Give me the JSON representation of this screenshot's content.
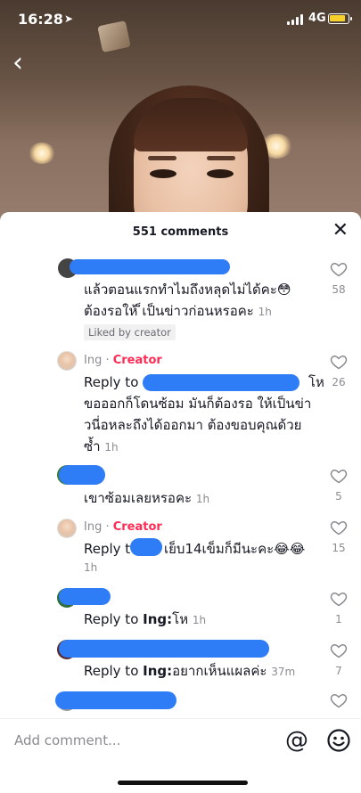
{
  "status_bar": {
    "time": "16:28",
    "network": "4G",
    "battery_color": "#f7d02c"
  },
  "sheet": {
    "comment_count": "551 comments"
  },
  "comments": [
    {
      "text_line1": "แล้วตอนแรกทำไมถึงหลุดไม่ได้คะ😳",
      "text_line2": "ต้องรอให้ ็เป็นข่าวก่อนหรอคะ",
      "time": "1h",
      "likes": "58",
      "badge": "Liked by creator"
    },
    {
      "username": "Ing",
      "creator_label": "Creator",
      "reply_prefix": "Reply to",
      "text_end": "โห",
      "text_line2": "ขอออกก็โดนซ้อม มันก็ต้องรอ ให้เป็นข่า",
      "text_line3": "วนี่อหละถึงได้ออกมา ต้องขอบคุณด้วย",
      "text_line4": "ซ้ำ",
      "time": "1h",
      "likes": "26"
    },
    {
      "text": "เขาซ้อมเลยหรอคะ",
      "time": "1h",
      "likes": "5"
    },
    {
      "username": "Ing",
      "creator_label": "Creator",
      "reply_prefix": "Reply t",
      "text_end": "เย็บ14เข็มก็มีนะคะ😂😂",
      "time": "1h",
      "likes": "15"
    },
    {
      "reply_prefix": "Reply to",
      "reply_target": "Ing:",
      "text": "โห",
      "time": "1h",
      "likes": "1"
    },
    {
      "reply_prefix": "Reply to",
      "reply_target": "Ing:",
      "text": "อยากเห็นแผลค่ะ",
      "time": "37m",
      "likes": "7"
    }
  ],
  "input": {
    "placeholder": "Add comment...",
    "accent": "#fe2c55"
  }
}
